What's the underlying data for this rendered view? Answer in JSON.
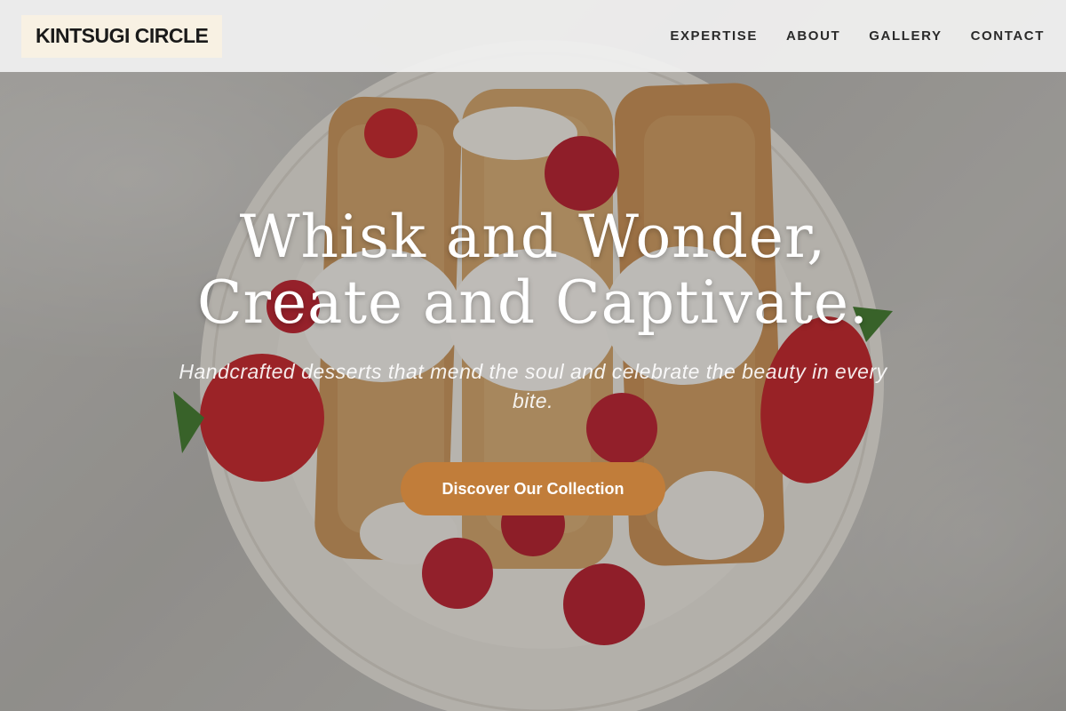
{
  "header": {
    "logo": "KINTSUGI CIRCLE",
    "nav": [
      "EXPERTISE",
      "ABOUT",
      "GALLERY",
      "CONTACT"
    ]
  },
  "hero": {
    "headline_line1": "Whisk and Wonder,",
    "headline_line2": "Create and Captivate.",
    "subheadline": "Handcrafted desserts that mend the soul and celebrate the beauty in every bite.",
    "cta_label": "Discover Our Collection",
    "background_image": "plate of crepes with whipped cream, raspberries and strawberries on marble"
  },
  "colors": {
    "accent": "#c17d3a",
    "logo_bg": "#f8f1e3",
    "header_bg": "#f0f0f0"
  }
}
